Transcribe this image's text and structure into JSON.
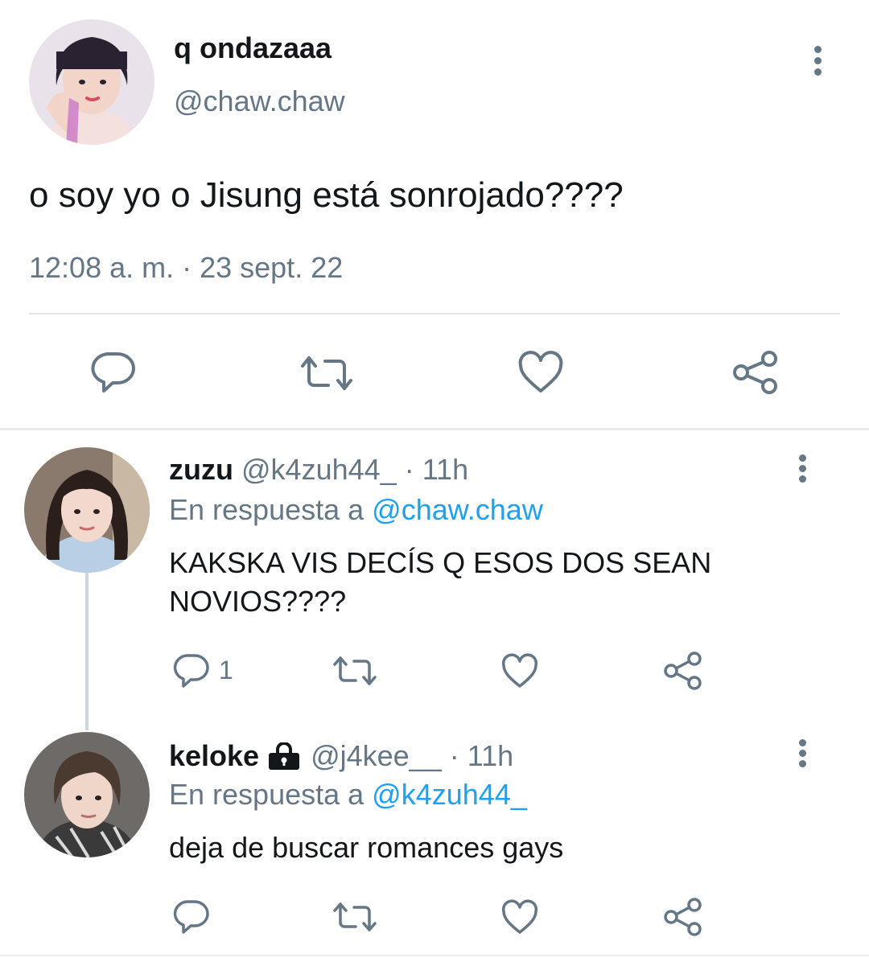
{
  "main_tweet": {
    "display_name": "q ondazaaa",
    "handle": "@chaw.chaw",
    "text": "o soy yo o Jisung está sonrojado????",
    "timestamp": "12:08 a. m. · 23 sept. 22"
  },
  "replies": [
    {
      "display_name": "zuzu",
      "handle": "@k4zuh44_",
      "time": "· 11h",
      "reply_prefix": "En respuesta a",
      "reply_to": "@chaw.chaw",
      "text_lines": [
        "KAKSKA VIS DECÍS Q ESOS DOS SEAN",
        "NOVIOS????"
      ],
      "reply_count": "1"
    },
    {
      "display_name": "keloke",
      "locked": true,
      "handle": "@j4kee__",
      "time": "· 11h",
      "reply_prefix": "En respuesta a",
      "reply_to": "@k4zuh44_",
      "text_lines": [
        "deja de buscar romances gays"
      ],
      "reply_count": ""
    }
  ],
  "icons": {
    "reply": "speech-bubble-icon",
    "retweet": "retweet-arrows-icon",
    "like": "heart-outline-icon",
    "share": "share-nodes-icon",
    "more": "vertical-dots-icon",
    "lock": "padlock-icon"
  },
  "colors": {
    "text": "#14171a",
    "secondary": "#657786",
    "link": "#1da1f2",
    "divider": "#e1e8ed"
  }
}
